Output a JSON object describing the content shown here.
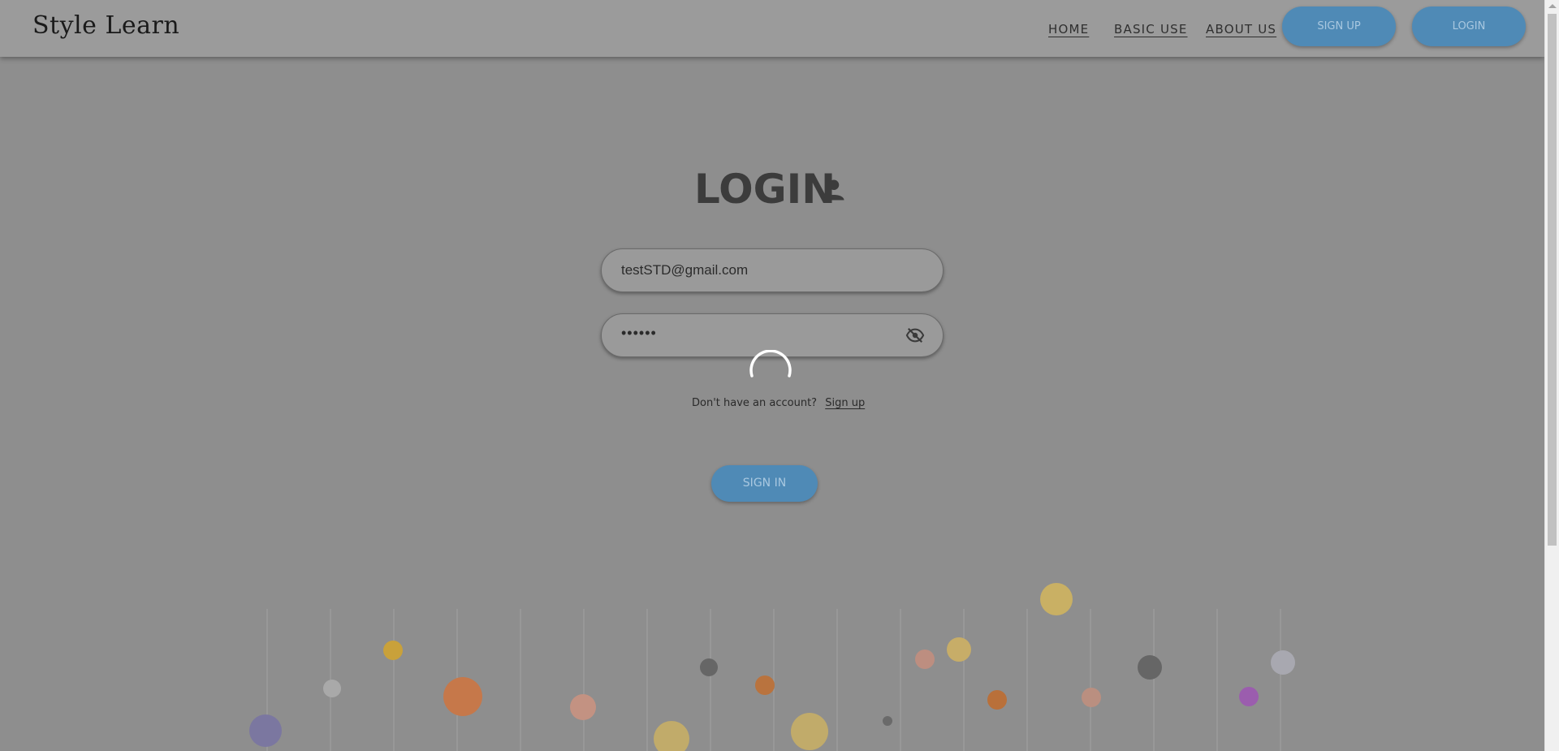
{
  "header": {
    "logo_text": "Style Learn",
    "nav_links": [
      "HOME",
      "BASIC USE",
      "ABOUT US"
    ],
    "signup_button": "SIGN UP",
    "login_button": "LOGIN"
  },
  "login": {
    "title": "LOGIN",
    "email_value": "testSTD@gmail.com",
    "password_value": "••••••",
    "no_account_text": "Don't have an account?",
    "signup_link": "Sign up",
    "submit_button": "SIGN IN"
  },
  "colors": {
    "overlay_background": "#8e8e8e",
    "button_blue": "#4f8ab6"
  }
}
